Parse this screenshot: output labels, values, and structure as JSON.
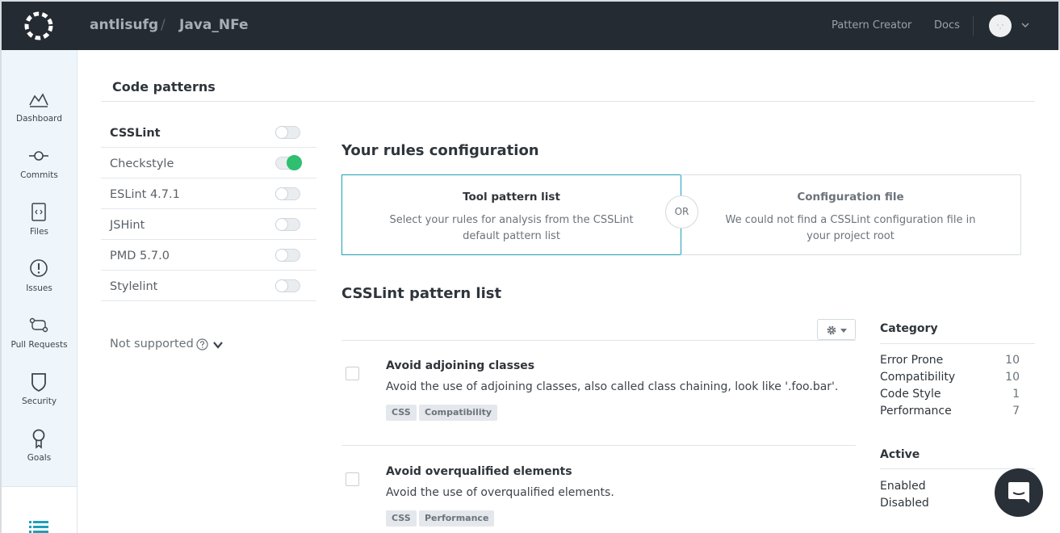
{
  "header": {
    "org": "antlisufg",
    "separator": "/",
    "repo": "Java_NFe",
    "links": [
      {
        "label": "Pattern Creator"
      },
      {
        "label": "Docs"
      }
    ]
  },
  "sidebar": {
    "items": [
      {
        "label": "Dashboard",
        "icon": "chart-icon"
      },
      {
        "label": "Commits",
        "icon": "commit-icon"
      },
      {
        "label": "Files",
        "icon": "file-code-icon"
      },
      {
        "label": "Issues",
        "icon": "alert-circle-icon"
      },
      {
        "label": "Pull Requests",
        "icon": "pull-request-icon"
      },
      {
        "label": "Security",
        "icon": "shield-icon"
      },
      {
        "label": "Goals",
        "icon": "goal-icon"
      }
    ],
    "bottom_icon": "list-icon"
  },
  "page": {
    "title": "Code patterns"
  },
  "tools": [
    {
      "name": "CSSLint",
      "enabled": false,
      "selected": true
    },
    {
      "name": "Checkstyle",
      "enabled": true,
      "selected": false
    },
    {
      "name": "ESLint 4.7.1",
      "enabled": false,
      "selected": false
    },
    {
      "name": "JSHint",
      "enabled": false,
      "selected": false
    },
    {
      "name": "PMD 5.7.0",
      "enabled": false,
      "selected": false
    },
    {
      "name": "Stylelint",
      "enabled": false,
      "selected": false
    }
  ],
  "not_supported": "Not supported",
  "config": {
    "heading": "Your rules configuration",
    "option_left": {
      "title": "Tool pattern list",
      "desc": "Select your rules for analysis from the CSSLint default pattern list"
    },
    "or": "OR",
    "option_right": {
      "title": "Configuration file",
      "desc": "We could not find a CSSLint configuration file in your project root"
    }
  },
  "pattern_list": {
    "heading": "CSSLint pattern list",
    "patterns": [
      {
        "title": "Avoid adjoining classes",
        "desc": "Avoid the use of adjoining classes, also called class chaining, look like '.foo.bar'.",
        "tags": [
          "CSS",
          "Compatibility"
        ]
      },
      {
        "title": "Avoid overqualified elements",
        "desc": "Avoid the use of overqualified elements.",
        "tags": [
          "CSS",
          "Performance"
        ]
      }
    ]
  },
  "filters": {
    "category_heading": "Category",
    "categories": [
      {
        "name": "Error Prone",
        "count": "10"
      },
      {
        "name": "Compatibility",
        "count": "10"
      },
      {
        "name": "Code Style",
        "count": "1"
      },
      {
        "name": "Performance",
        "count": "7"
      }
    ],
    "active_heading": "Active",
    "active": [
      {
        "name": "Enabled"
      },
      {
        "name": "Disabled"
      }
    ]
  },
  "colors": {
    "topbar": "#252b33",
    "accent": "#1fa0b7",
    "toggle_on": "#2fbf71",
    "sidebar_bg": "#eef6fb"
  }
}
